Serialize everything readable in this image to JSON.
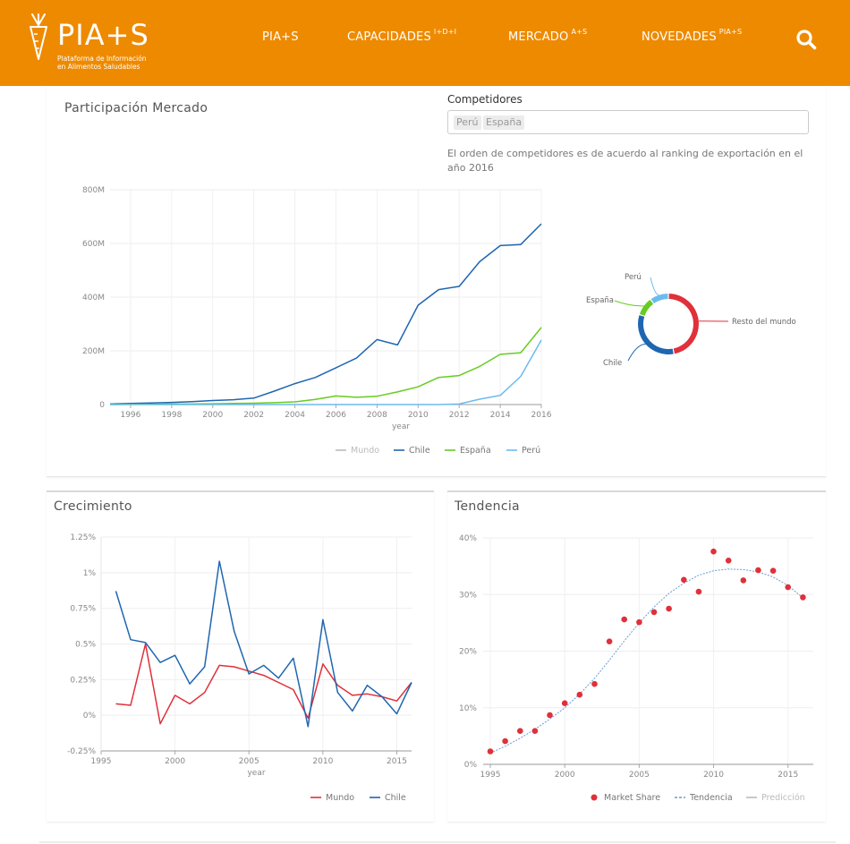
{
  "header": {
    "logo_title": "PIA+S",
    "logo_subtitle_1": "Plataforma de Información",
    "logo_subtitle_2": "en Alimentos Saludables",
    "nav": [
      {
        "label": "PIA+S",
        "sup": ""
      },
      {
        "label": "CAPACIDADES",
        "sup": "I+D+I"
      },
      {
        "label": "MERCADO",
        "sup": "A+S"
      },
      {
        "label": "NOVEDADES",
        "sup": "PIA+S"
      }
    ],
    "search_icon": "search-icon"
  },
  "colors": {
    "brand": "#ee8a00",
    "mundo": "#e0303a",
    "chile": "#1f66b1",
    "espana": "#66cc22",
    "peru": "#6cbbee",
    "grey_legend": "#bbbbbb",
    "trend": "#6b9bd1"
  },
  "market": {
    "title": "Participación Mercado",
    "competitors_label": "Competidores",
    "competitor_tags": [
      "Perú",
      "España"
    ],
    "note": "El orden de competidores es de acuerdo al ranking de exportación en el año 2016"
  },
  "growth": {
    "title": "Crecimiento"
  },
  "trend": {
    "title": "Tendencia"
  },
  "chart_data": [
    {
      "type": "line",
      "xlabel": "year",
      "ylabel": "",
      "ylim": [
        0,
        800000000
      ],
      "y_ticks": [
        0,
        200000000,
        400000000,
        600000000,
        800000000
      ],
      "y_tick_labels": [
        "0",
        "200M",
        "400M",
        "600M",
        "800M"
      ],
      "x_ticks": [
        1996,
        1998,
        2000,
        2002,
        2004,
        2006,
        2008,
        2010,
        2012,
        2014,
        2016
      ],
      "x": [
        1995,
        1996,
        1997,
        1998,
        1999,
        2000,
        2001,
        2002,
        2003,
        2004,
        2005,
        2006,
        2007,
        2008,
        2009,
        2010,
        2011,
        2012,
        2013,
        2014,
        2015,
        2016
      ],
      "legend": [
        "Mundo",
        "Chile",
        "España",
        "Perú"
      ],
      "legend_placement": "bottom",
      "series": [
        {
          "name": "Chile",
          "values": [
            2000000,
            4000000,
            6000000,
            8000000,
            11000000,
            15000000,
            18000000,
            24000000,
            50000000,
            78000000,
            101000000,
            137000000,
            173000000,
            242000000,
            222000000,
            370000000,
            428000000,
            440000000,
            532000000,
            592000000,
            596000000,
            673000000
          ]
        },
        {
          "name": "España",
          "values": [
            0,
            1000000,
            1000000,
            2000000,
            2000000,
            3000000,
            4000000,
            5000000,
            7000000,
            10000000,
            19000000,
            32000000,
            27000000,
            31000000,
            47000000,
            66000000,
            101000000,
            108000000,
            142000000,
            187000000,
            193000000,
            287000000
          ]
        },
        {
          "name": "Perú",
          "values": [
            0,
            0,
            0,
            0,
            0,
            0,
            0,
            0,
            0,
            0,
            0,
            0,
            0,
            0,
            0,
            0,
            0,
            2000000,
            20000000,
            34000000,
            105000000,
            240000000
          ]
        }
      ]
    },
    {
      "type": "pie",
      "labels": [
        "Resto del mundo",
        "Chile",
        "España",
        "Perú"
      ],
      "values": [
        47,
        33,
        10,
        10
      ]
    },
    {
      "type": "line",
      "xlabel": "year",
      "ylabel": "",
      "ylim": [
        -0.25,
        1.25
      ],
      "y_ticks": [
        -0.25,
        0,
        0.25,
        0.5,
        0.75,
        1,
        1.25
      ],
      "y_tick_labels": [
        "-0.25%",
        "0%",
        "0.25%",
        "0.5%",
        "0.75%",
        "1%",
        "1.25%"
      ],
      "x_ticks": [
        1995,
        2000,
        2005,
        2010,
        2015
      ],
      "x": [
        1996,
        1997,
        1998,
        1999,
        2000,
        2001,
        2002,
        2003,
        2004,
        2005,
        2006,
        2007,
        2008,
        2009,
        2010,
        2011,
        2012,
        2013,
        2014,
        2015,
        2016
      ],
      "legend": [
        "Mundo",
        "Chile"
      ],
      "legend_placement": "bottom-right",
      "series": [
        {
          "name": "Mundo",
          "values": [
            0.08,
            0.07,
            0.5,
            -0.06,
            0.14,
            0.08,
            0.16,
            0.35,
            0.34,
            0.31,
            0.28,
            0.23,
            0.18,
            -0.02,
            0.36,
            0.21,
            0.14,
            0.15,
            0.13,
            0.1,
            0.23
          ]
        },
        {
          "name": "Chile",
          "values": [
            0.87,
            0.53,
            0.51,
            0.37,
            0.42,
            0.22,
            0.34,
            1.08,
            0.59,
            0.29,
            0.35,
            0.26,
            0.4,
            -0.08,
            0.67,
            0.16,
            0.03,
            0.21,
            0.13,
            0.01,
            0.23
          ]
        }
      ]
    },
    {
      "type": "scatter",
      "xlabel": "",
      "ylabel": "",
      "xlim": [
        1995,
        2016
      ],
      "ylim": [
        0,
        40
      ],
      "y_ticks": [
        0,
        10,
        20,
        30,
        40
      ],
      "y_tick_labels": [
        "0%",
        "10%",
        "20%",
        "30%",
        "40%"
      ],
      "x_ticks": [
        1995,
        2000,
        2005,
        2010,
        2015
      ],
      "legend": [
        "Market Share",
        "Tendencia",
        "Predicción"
      ],
      "legend_placement": "bottom",
      "series": [
        {
          "name": "Market Share",
          "x": [
            1995,
            1996,
            1997,
            1998,
            1999,
            2000,
            2001,
            2002,
            2003,
            2004,
            2005,
            2006,
            2007,
            2008,
            2009,
            2010,
            2011,
            2012,
            2013,
            2014,
            2015,
            2016
          ],
          "values": [
            2.3,
            4.1,
            5.9,
            5.9,
            8.7,
            10.8,
            12.3,
            14.2,
            21.7,
            25.6,
            25.1,
            26.9,
            27.5,
            32.6,
            30.5,
            37.6,
            36.0,
            32.5,
            34.3,
            34.2,
            31.3,
            29.5
          ]
        },
        {
          "name": "Tendencia",
          "x": [
            1995,
            1996,
            1997,
            1998,
            1999,
            2000,
            2001,
            2002,
            2003,
            2004,
            2005,
            2006,
            2007,
            2008,
            2009,
            2010,
            2011,
            2012,
            2013,
            2014,
            2015,
            2016
          ],
          "values": [
            2.0,
            3.2,
            4.6,
            6.2,
            8.0,
            10.0,
            12.4,
            15.2,
            18.4,
            21.8,
            25.0,
            27.8,
            30.2,
            32.0,
            33.4,
            34.2,
            34.5,
            34.4,
            34.0,
            33.1,
            31.6,
            29.4
          ]
        }
      ]
    }
  ]
}
